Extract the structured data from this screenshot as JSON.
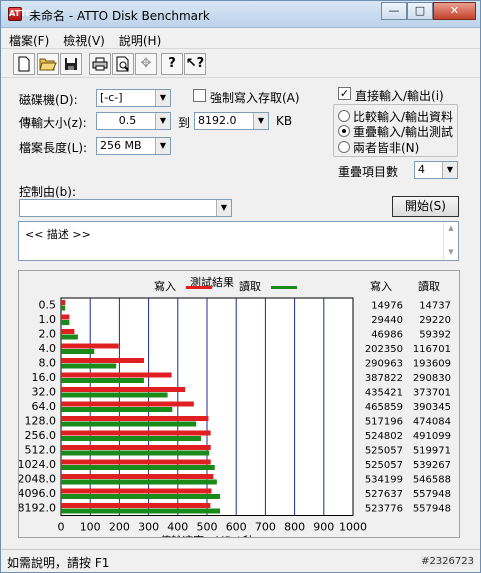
{
  "window": {
    "title": "未命名 - ATTO Disk Benchmark",
    "minimize": "—",
    "maximize": "□",
    "close": "✕",
    "app_icon": "ATTO"
  },
  "menu": [
    "檔案(F)",
    "檢視(V)",
    "說明(H)"
  ],
  "toolbar": [
    "new-icon",
    "open-icon",
    "save-icon",
    "print-icon",
    "print-preview-icon",
    "move-icon",
    "help-icon",
    "context-help-icon"
  ],
  "form": {
    "drive_label": "磁碟機(D):",
    "drive_value": "[-c-]",
    "transfer_label": "傳輸大小(z):",
    "transfer_from": "0.5",
    "to_label": "到",
    "transfer_to": "8192.0",
    "kb_label": "KB",
    "length_label": "檔案長度(L):",
    "length_value": "256 MB",
    "force_write_label": "強制寫入存取(A)",
    "force_write_checked": false,
    "direct_io_label": "直接輸入/輸出(i)",
    "direct_io_checked": true,
    "radio_options": [
      "比較輸入/輸出資料",
      "重疊輸入/輸出測試",
      "兩者皆非(N)"
    ],
    "radio_selected": 1,
    "queue_label": "重疊項目數",
    "queue_value": "4",
    "control_label": "控制由(b):",
    "control_value": "",
    "start_button": "開始(S)",
    "description": "<<   描述   >>"
  },
  "status": {
    "help_text": "如需說明，請按 F1",
    "watermark": "#2326723"
  },
  "chart_data": {
    "type": "bar",
    "title": "測試結果",
    "legend": [
      {
        "name": "寫入",
        "color": "#e02020"
      },
      {
        "name": "讀取",
        "color": "#1a8a1a"
      }
    ],
    "categories": [
      "0.5",
      "1.0",
      "2.0",
      "4.0",
      "8.0",
      "16.0",
      "32.0",
      "64.0",
      "128.0",
      "256.0",
      "512.0",
      "1024.0",
      "2048.0",
      "4096.0",
      "8192.0"
    ],
    "series": [
      {
        "name": "寫入",
        "values": [
          14976,
          29440,
          46986,
          202350,
          290963,
          387822,
          435421,
          465859,
          517196,
          524802,
          525057,
          525057,
          534199,
          527637,
          523776
        ]
      },
      {
        "name": "讀取",
        "values": [
          14737,
          29220,
          59392,
          116701,
          193609,
          290830,
          373701,
          390345,
          474084,
          491099,
          519971,
          539267,
          546588,
          557948,
          557948
        ]
      }
    ],
    "write_column_label": "寫入",
    "read_column_label": "讀取",
    "xlabel": "傳輸速率 - MB / 秒",
    "xticks": [
      0,
      100,
      200,
      300,
      400,
      500,
      600,
      700,
      800,
      900,
      1000
    ],
    "xlim": [
      0,
      1000
    ]
  }
}
